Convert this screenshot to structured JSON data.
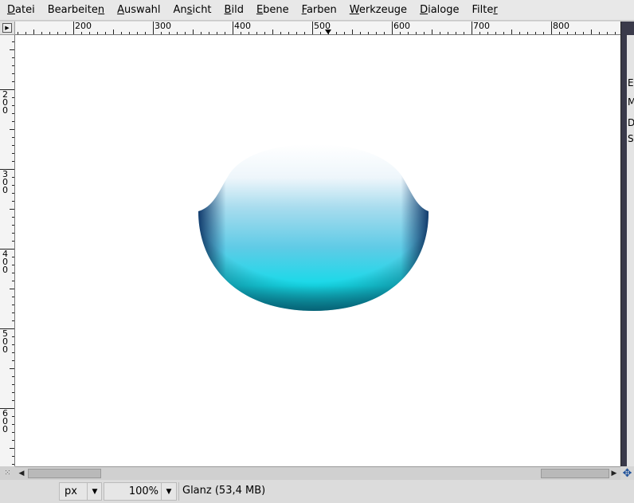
{
  "menu": [
    {
      "pre": "",
      "mn": "D",
      "post": "atei"
    },
    {
      "pre": "Bearbeite",
      "mn": "n",
      "post": ""
    },
    {
      "pre": "",
      "mn": "A",
      "post": "uswahl"
    },
    {
      "pre": "An",
      "mn": "s",
      "post": "icht"
    },
    {
      "pre": "",
      "mn": "B",
      "post": "ild"
    },
    {
      "pre": "",
      "mn": "E",
      "post": "bene"
    },
    {
      "pre": "",
      "mn": "F",
      "post": "arben"
    },
    {
      "pre": "",
      "mn": "W",
      "post": "erkzeuge"
    },
    {
      "pre": "",
      "mn": "D",
      "post": "ialoge"
    },
    {
      "pre": "Filte",
      "mn": "r",
      "post": ""
    }
  ],
  "ruler": {
    "h_labels": [
      "200",
      "300",
      "400",
      "500",
      "600",
      "700",
      "800"
    ],
    "v_labels": [
      "200",
      "300",
      "400",
      "500",
      "600"
    ]
  },
  "dock_letters": [
    "E",
    "M",
    "D",
    "S"
  ],
  "status": {
    "unit": "px",
    "zoom": "100%",
    "message": "Glanz (53,4 MB)"
  },
  "icons": {
    "ruler_corner": "navigate-icon",
    "scroll_left": "arrow-left-icon",
    "scroll_right": "arrow-right-icon",
    "quick_mask": "quick-mask-icon",
    "navigate": "navigate-move-icon",
    "dropdown": "dropdown-arrow-icon"
  },
  "colors": {
    "shape_top": "#ffffff",
    "shape_mid": "#7fd3ea",
    "shape_bottom": "#12d8ea",
    "shape_edge": "#0a3a6a"
  }
}
